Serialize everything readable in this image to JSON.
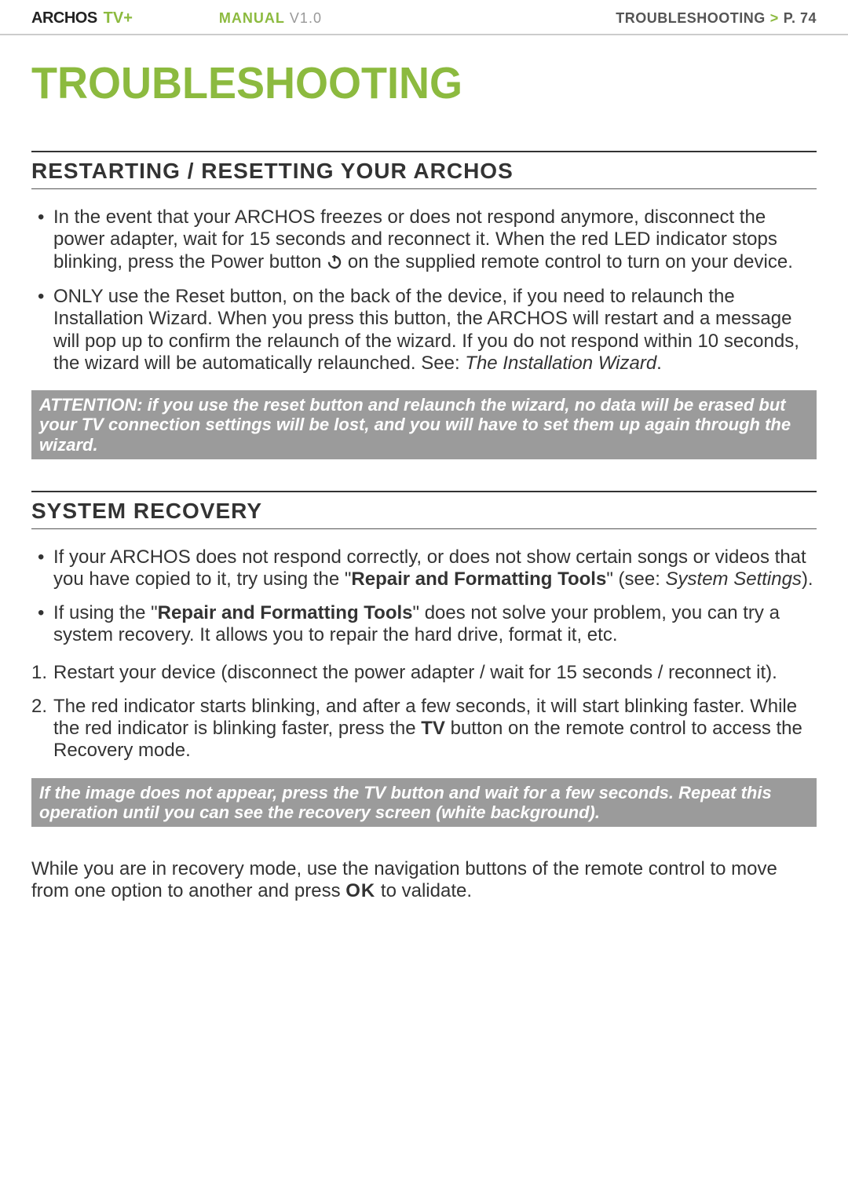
{
  "header": {
    "brand_main": "ARCHOS",
    "brand_sub": "TV+",
    "manual_label": "MANUAL",
    "manual_version": "V1.0",
    "section": "TROUBLESHOOTING",
    "arrow": ">",
    "page": "P. 74"
  },
  "page_title": "TROUBLESHOOTING",
  "section1": {
    "title": "RESTARTING / RESETTING YOUR ARCHOS",
    "b1_a": "In the event that your ARCHOS freezes or does not respond anymore, disconnect the power adapter, wait for 15 seconds and reconnect it. When the red LED indicator stops blinking, press the Power button ",
    "b1_b": " on the supplied remote control to turn on your device.",
    "b2_a": "ONLY use the Reset button, on the back of the device, if you need to relaunch the Installation Wizard. When you press this button, the ARCHOS will restart and a message will pop up to confirm the relaunch of the wizard. If you do not respond within 10 seconds, the wizard will be automatically relaunched. See: ",
    "b2_b": "The Installation Wizard",
    "b2_c": ".",
    "callout": "ATTENTION: if you use the reset button and relaunch the wizard, no data will be erased but your TV connection settings will be lost, and you will have to set them up again through the wizard."
  },
  "section2": {
    "title": "SYSTEM RECOVERY",
    "b1_a": "If your ARCHOS does not respond correctly, or does not show certain songs or videos that you have copied to it, try using the \"",
    "b1_b": "Repair and Formatting Tools",
    "b1_c": "\" (see: ",
    "b1_d": "System Settings",
    "b1_e": ").",
    "b2_a": "If using the \"",
    "b2_b": "Repair and Formatting Tools",
    "b2_c": "\" does not solve your problem, you can try a system recovery. It allows you to repair the hard drive, format it, etc.",
    "s1": "Restart your device (disconnect the power adapter / wait for 15 seconds / reconnect it).",
    "s2_a": "The red indicator starts blinking, and after a few seconds, it will start blinking faster. While the red indicator is blinking faster, press the ",
    "s2_b": "TV",
    "s2_c": " button on the remote control to access the Recovery mode.",
    "callout": "If the image does not appear, press the TV button and wait for a few seconds. Repeat this operation until you can see the recovery screen (white background).",
    "para_a": "While you are in recovery mode, use the navigation buttons of the remote control to move from one option to another and press ",
    "para_b": "OK",
    "para_c": " to validate."
  }
}
